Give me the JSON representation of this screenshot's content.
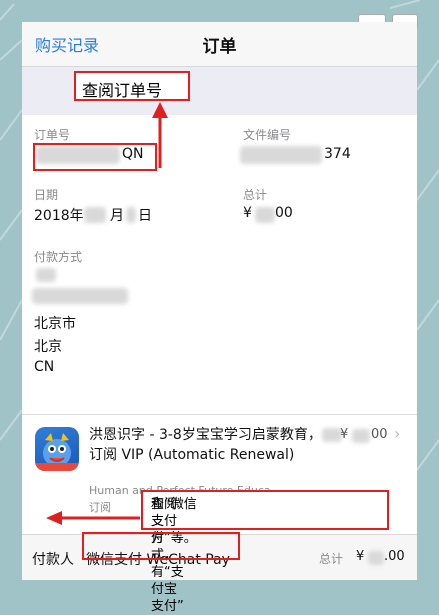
{
  "navbar": {
    "back_label": "购买记录",
    "title": "订单"
  },
  "order": {
    "order_no_label": "订单号",
    "order_no_value": "QN",
    "doc_no_label": "文件编号",
    "doc_no_value": "374",
    "date_label": "日期",
    "date_value_a": "2018年",
    "date_value_b": "月",
    "date_value_c": "日",
    "total_label": "总计",
    "total_value_a": "¥",
    "total_value_b": "00",
    "payment_label": "付款方式",
    "addr_line1": "北京市",
    "addr_line2": "北京",
    "addr_line3": "CN"
  },
  "item": {
    "title": "洪恩识字 - 3-8岁宝宝学习启蒙教育，",
    "title_b": "订阅 VIP (Automatic Renewal)",
    "developer": "Human and Perfect Future Educa",
    "type": "订阅",
    "price_a": "¥",
    "price_b": "00",
    "chevron": "›"
  },
  "footer": {
    "payer_label": "付款人",
    "method": "微信支付 WeChat Pay",
    "total_label": "总计",
    "total_a": "¥",
    "total_b": ".00"
  },
  "annotations": {
    "order_note": "查阅订单号",
    "payment_note_line1": "查阅支付方式，有“支付宝支付”",
    "payment_note_line2": "和“微信支付”等。"
  },
  "icons": {
    "app_icon": "dragon-mascot-icon",
    "arrow_up": "red-arrow-up-icon",
    "arrow_left": "red-arrow-left-icon"
  },
  "colors": {
    "link": "#2a7be4",
    "annotation": "#e02020"
  }
}
